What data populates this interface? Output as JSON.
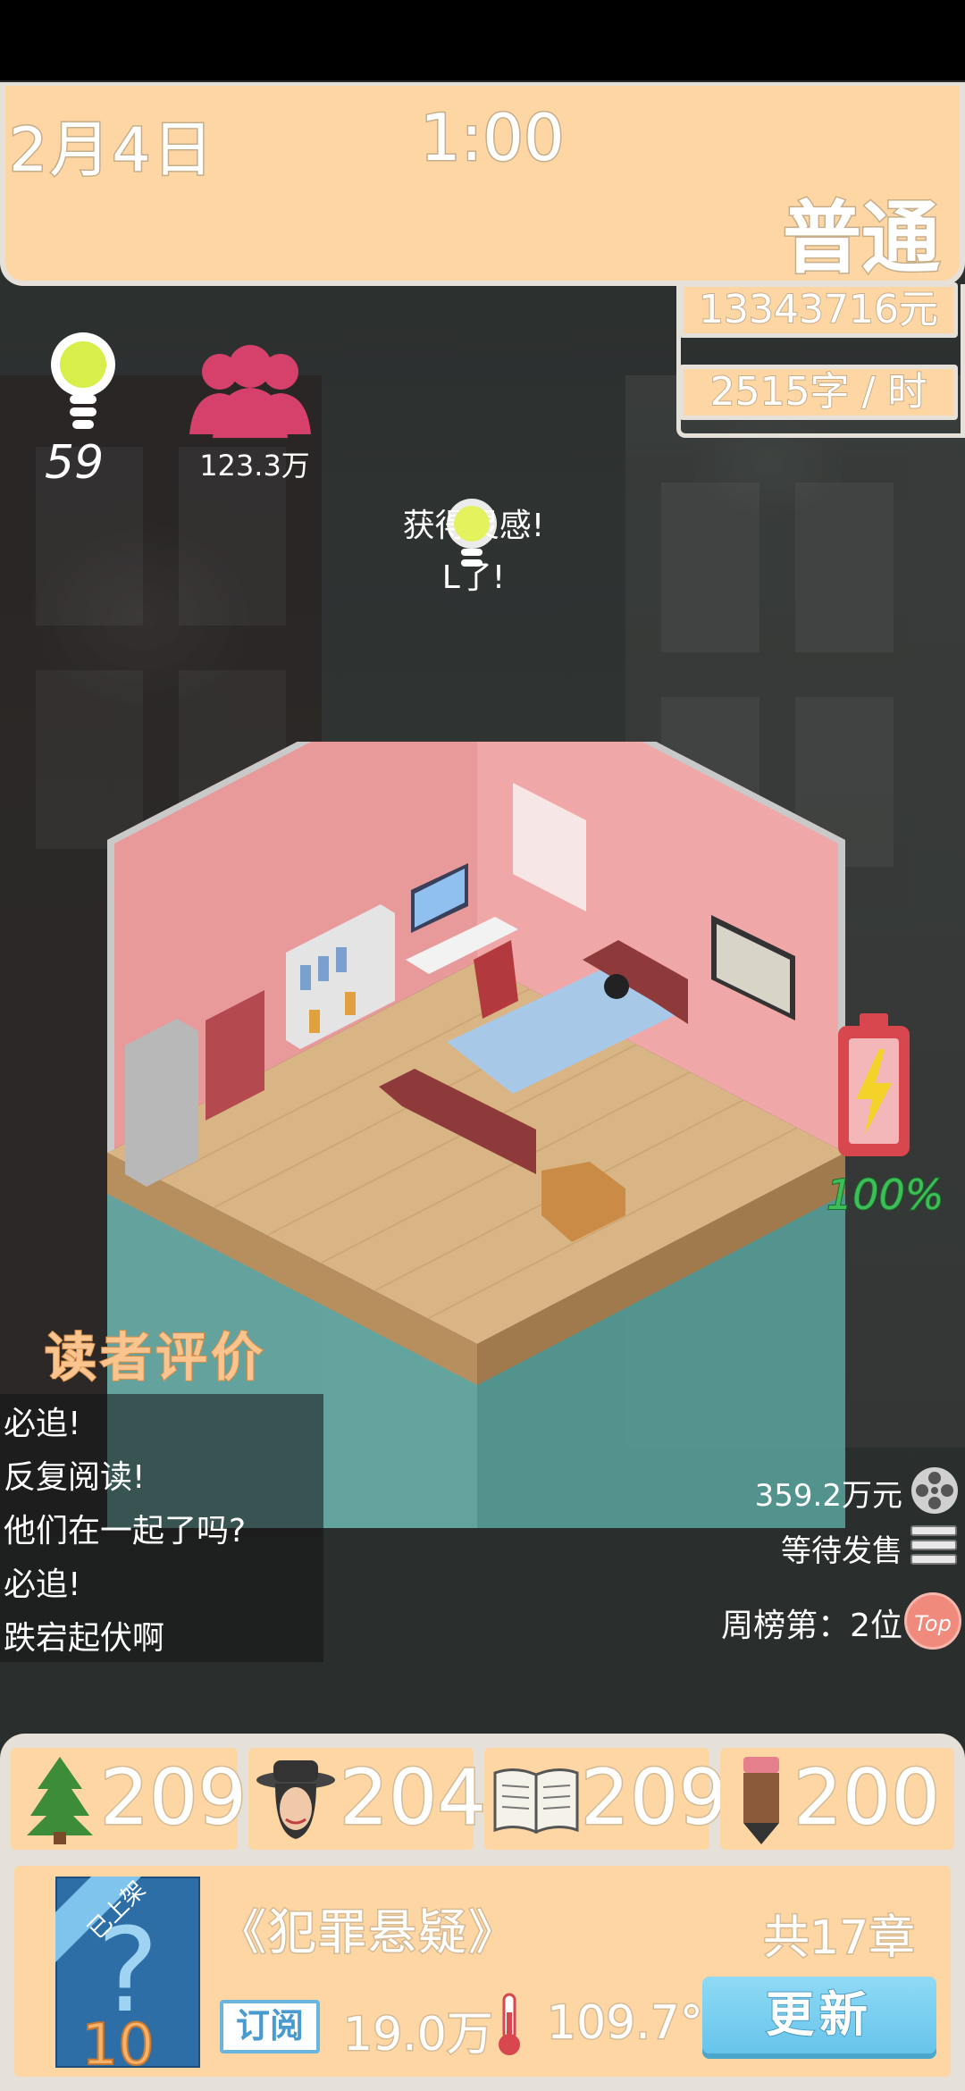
{
  "header": {
    "date": "2月4日",
    "time": "1:00",
    "mode": "普通"
  },
  "stats": {
    "money": "13343716元",
    "speed": "2515字 / 时"
  },
  "inspiration": {
    "value": "59"
  },
  "fans": {
    "value": "123.3万"
  },
  "notice": {
    "line1": "获得灵感!",
    "line2": "L了!"
  },
  "battery": {
    "percent_label": "100%",
    "level": 1.0
  },
  "reviews": {
    "title": "读者评价",
    "items": [
      "必追!",
      "反复阅读!",
      "他们在一起了吗?",
      "必追!",
      "跌宕起伏啊"
    ]
  },
  "book_info": {
    "revenue": "359.2万元",
    "status": "等待发售",
    "rank": "周榜第：2位",
    "rank_badge": "Top"
  },
  "resources": [
    {
      "icon": "tree-icon",
      "value": "209"
    },
    {
      "icon": "detective-icon",
      "value": "204"
    },
    {
      "icon": "open-book-icon",
      "value": "209"
    },
    {
      "icon": "pencil-icon",
      "value": "200"
    }
  ],
  "book": {
    "title": "《犯罪悬疑》",
    "chapters": "共17章",
    "ribbon": "已上架",
    "cover_number": "10",
    "subscribe_label": "订阅",
    "subscribers": "19.0万",
    "heat": "109.7°",
    "update_button": "更新"
  },
  "colors": {
    "panel": "#fdd6a3",
    "panel_border": "#e5e0d8",
    "battery_green": "#3cbf57",
    "button_blue": "#66c4ea"
  }
}
